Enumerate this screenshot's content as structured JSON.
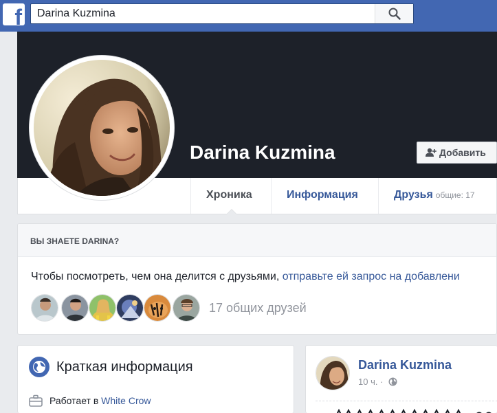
{
  "header": {
    "logo_letter": "f",
    "search_value": "Darina Kuzmina"
  },
  "profile": {
    "name": "Darina Kuzmina",
    "add_button_label": "Добавить"
  },
  "tabs": [
    {
      "label": "Хроника",
      "active": true
    },
    {
      "label": "Информация",
      "active": false
    },
    {
      "label": "Друзья",
      "active": false,
      "count_text": "общие: 17"
    }
  ],
  "know_box": {
    "header": "ВЫ ЗНАЕТЕ DARINA?",
    "text": "Чтобы посмотреть, чем она делится с друзьями, ",
    "link": "отправьте ей запрос на добавлени",
    "mutual_friends": "17 общих друзей"
  },
  "intro": {
    "title": "Краткая информация",
    "work_prefix": "Работает в ",
    "work_link": "White Crow"
  },
  "post": {
    "author": "Darina Kuzmina",
    "time": "10 ч. ·"
  },
  "colors": {
    "brand": "#4267b2",
    "link": "#365899",
    "cover": "#1d2129",
    "background": "#e9ebee"
  }
}
